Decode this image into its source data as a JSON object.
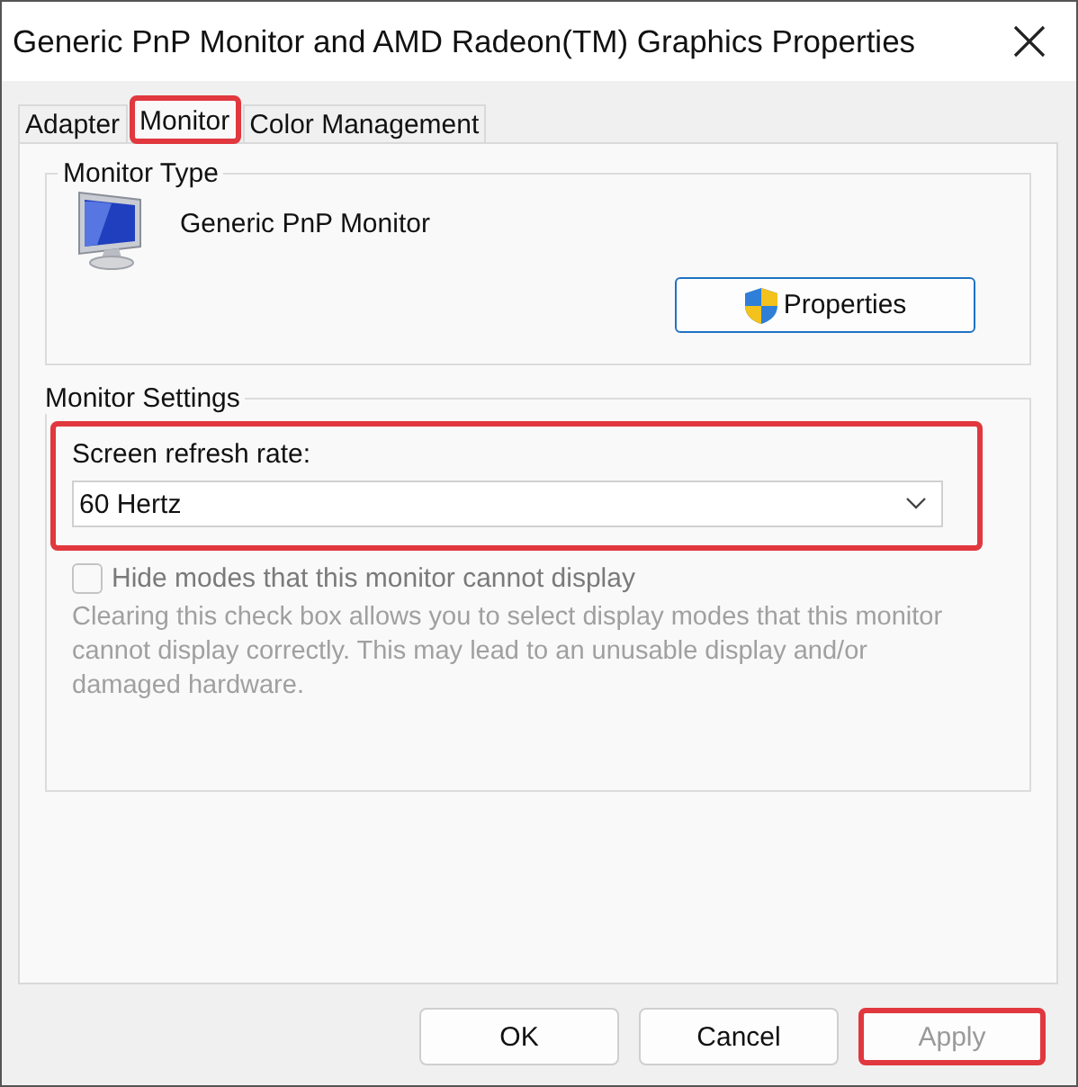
{
  "window": {
    "title": "Generic PnP Monitor and AMD Radeon(TM) Graphics Properties"
  },
  "tabs": [
    {
      "label": "Adapter",
      "selected": false,
      "highlighted": false
    },
    {
      "label": "Monitor",
      "selected": true,
      "highlighted": true
    },
    {
      "label": "Color Management",
      "selected": false,
      "highlighted": false
    }
  ],
  "monitor_type": {
    "legend": "Monitor Type",
    "device_name": "Generic PnP Monitor",
    "properties_button": "Properties"
  },
  "monitor_settings": {
    "legend": "Monitor Settings",
    "refresh_rate": {
      "label": "Screen refresh rate:",
      "value": "60 Hertz",
      "highlighted": true
    },
    "hide_modes": {
      "label": "Hide modes that this monitor cannot display",
      "checked": false,
      "disabled": true
    },
    "description": "Clearing this check box allows you to select display modes that this monitor cannot display correctly. This may lead to an unusable display and/or damaged hardware."
  },
  "buttons": [
    {
      "label": "OK",
      "disabled": false,
      "highlighted": false
    },
    {
      "label": "Cancel",
      "disabled": false,
      "highlighted": false
    },
    {
      "label": "Apply",
      "disabled": true,
      "highlighted": true
    }
  ]
}
